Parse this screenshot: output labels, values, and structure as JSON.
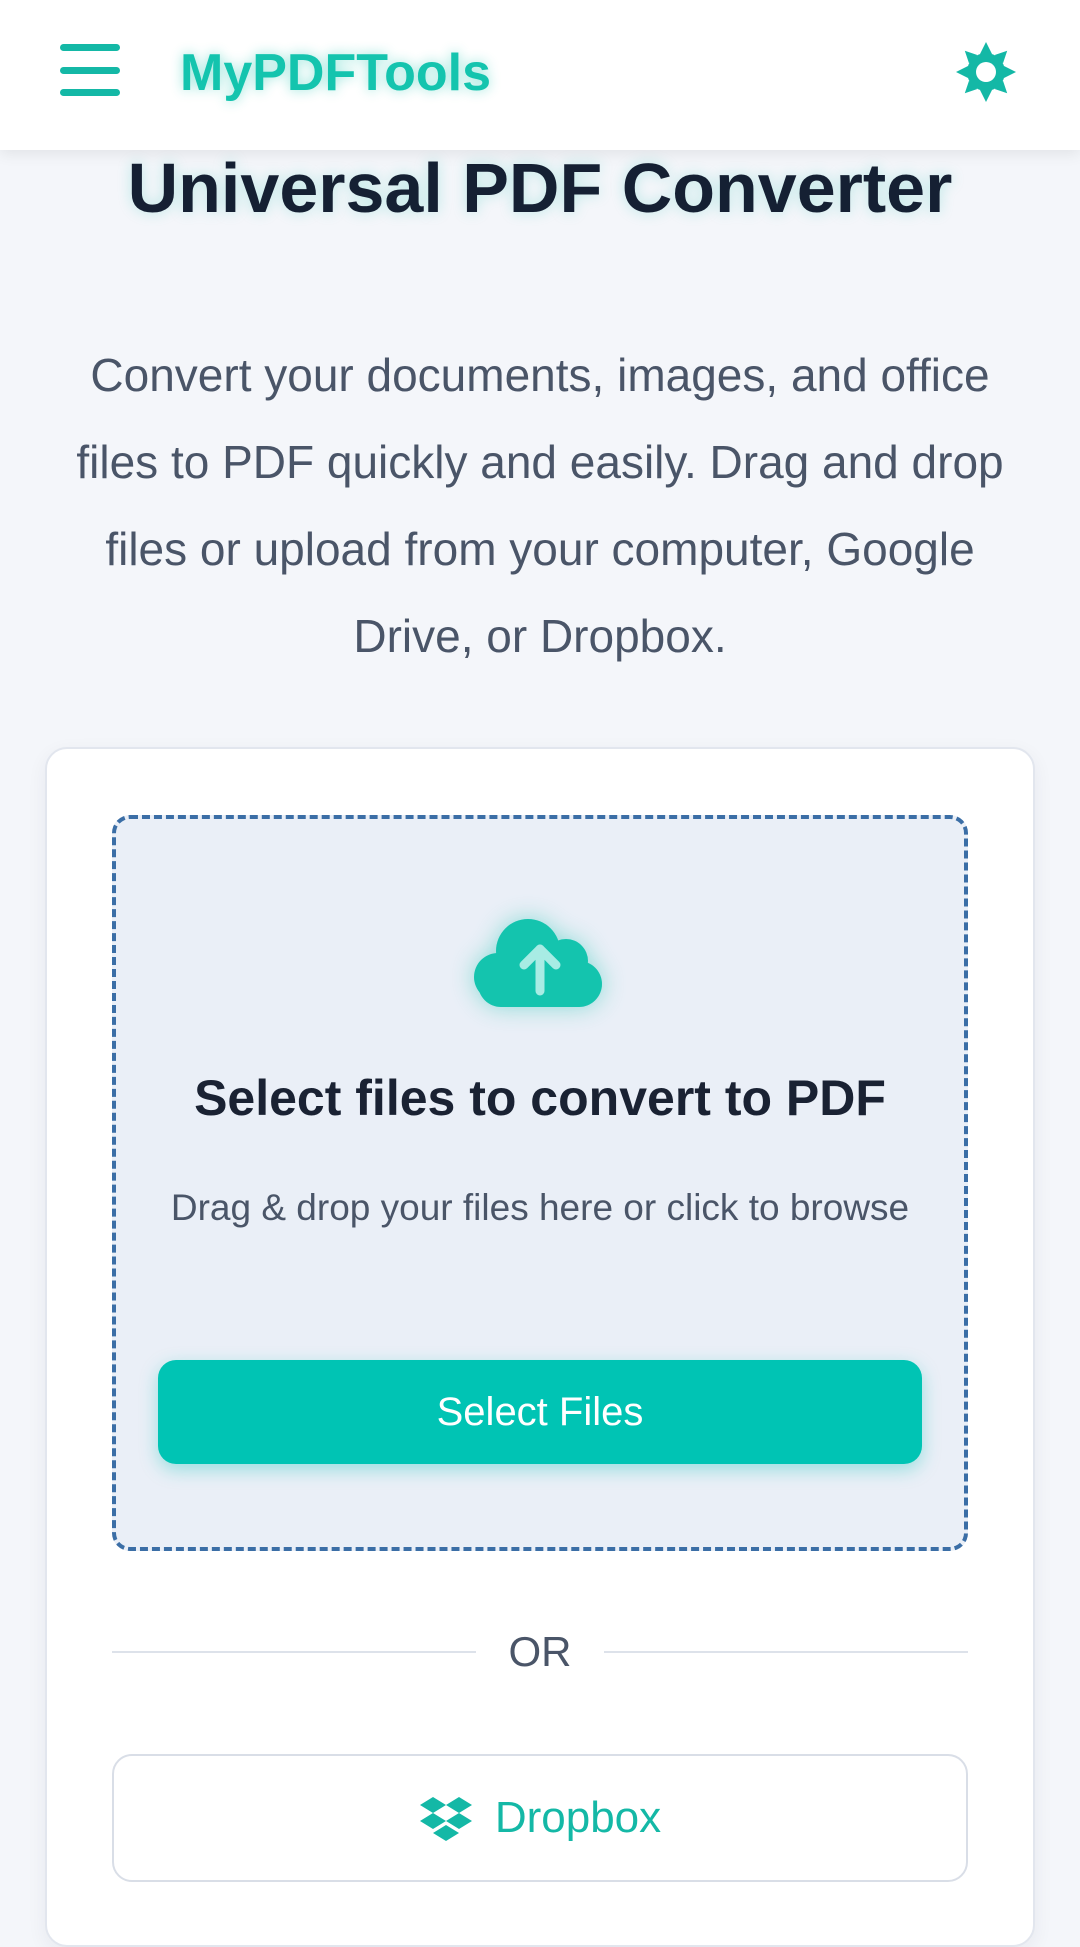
{
  "header": {
    "brand": "MyPDFTools",
    "menu_icon": "hamburger-menu-icon",
    "theme_icon": "sun-icon"
  },
  "main": {
    "title": "Universal PDF Converter",
    "description": "Convert your documents, images, and office files to PDF quickly and easily. Drag and drop files or upload from your computer, Google Drive, or Dropbox."
  },
  "dropzone": {
    "icon": "cloud-upload-icon",
    "title": "Select files to convert to PDF",
    "subtitle": "Drag & drop your files here or click to browse",
    "button_label": "Select Files"
  },
  "divider": {
    "text": "OR"
  },
  "cloud_sources": [
    {
      "label": "Dropbox",
      "icon": "dropbox-icon"
    }
  ],
  "colors": {
    "accent": "#00c4b4",
    "brand": "#14c4ae",
    "dropzone_border": "#3b6ea6",
    "title_text": "#152033"
  }
}
